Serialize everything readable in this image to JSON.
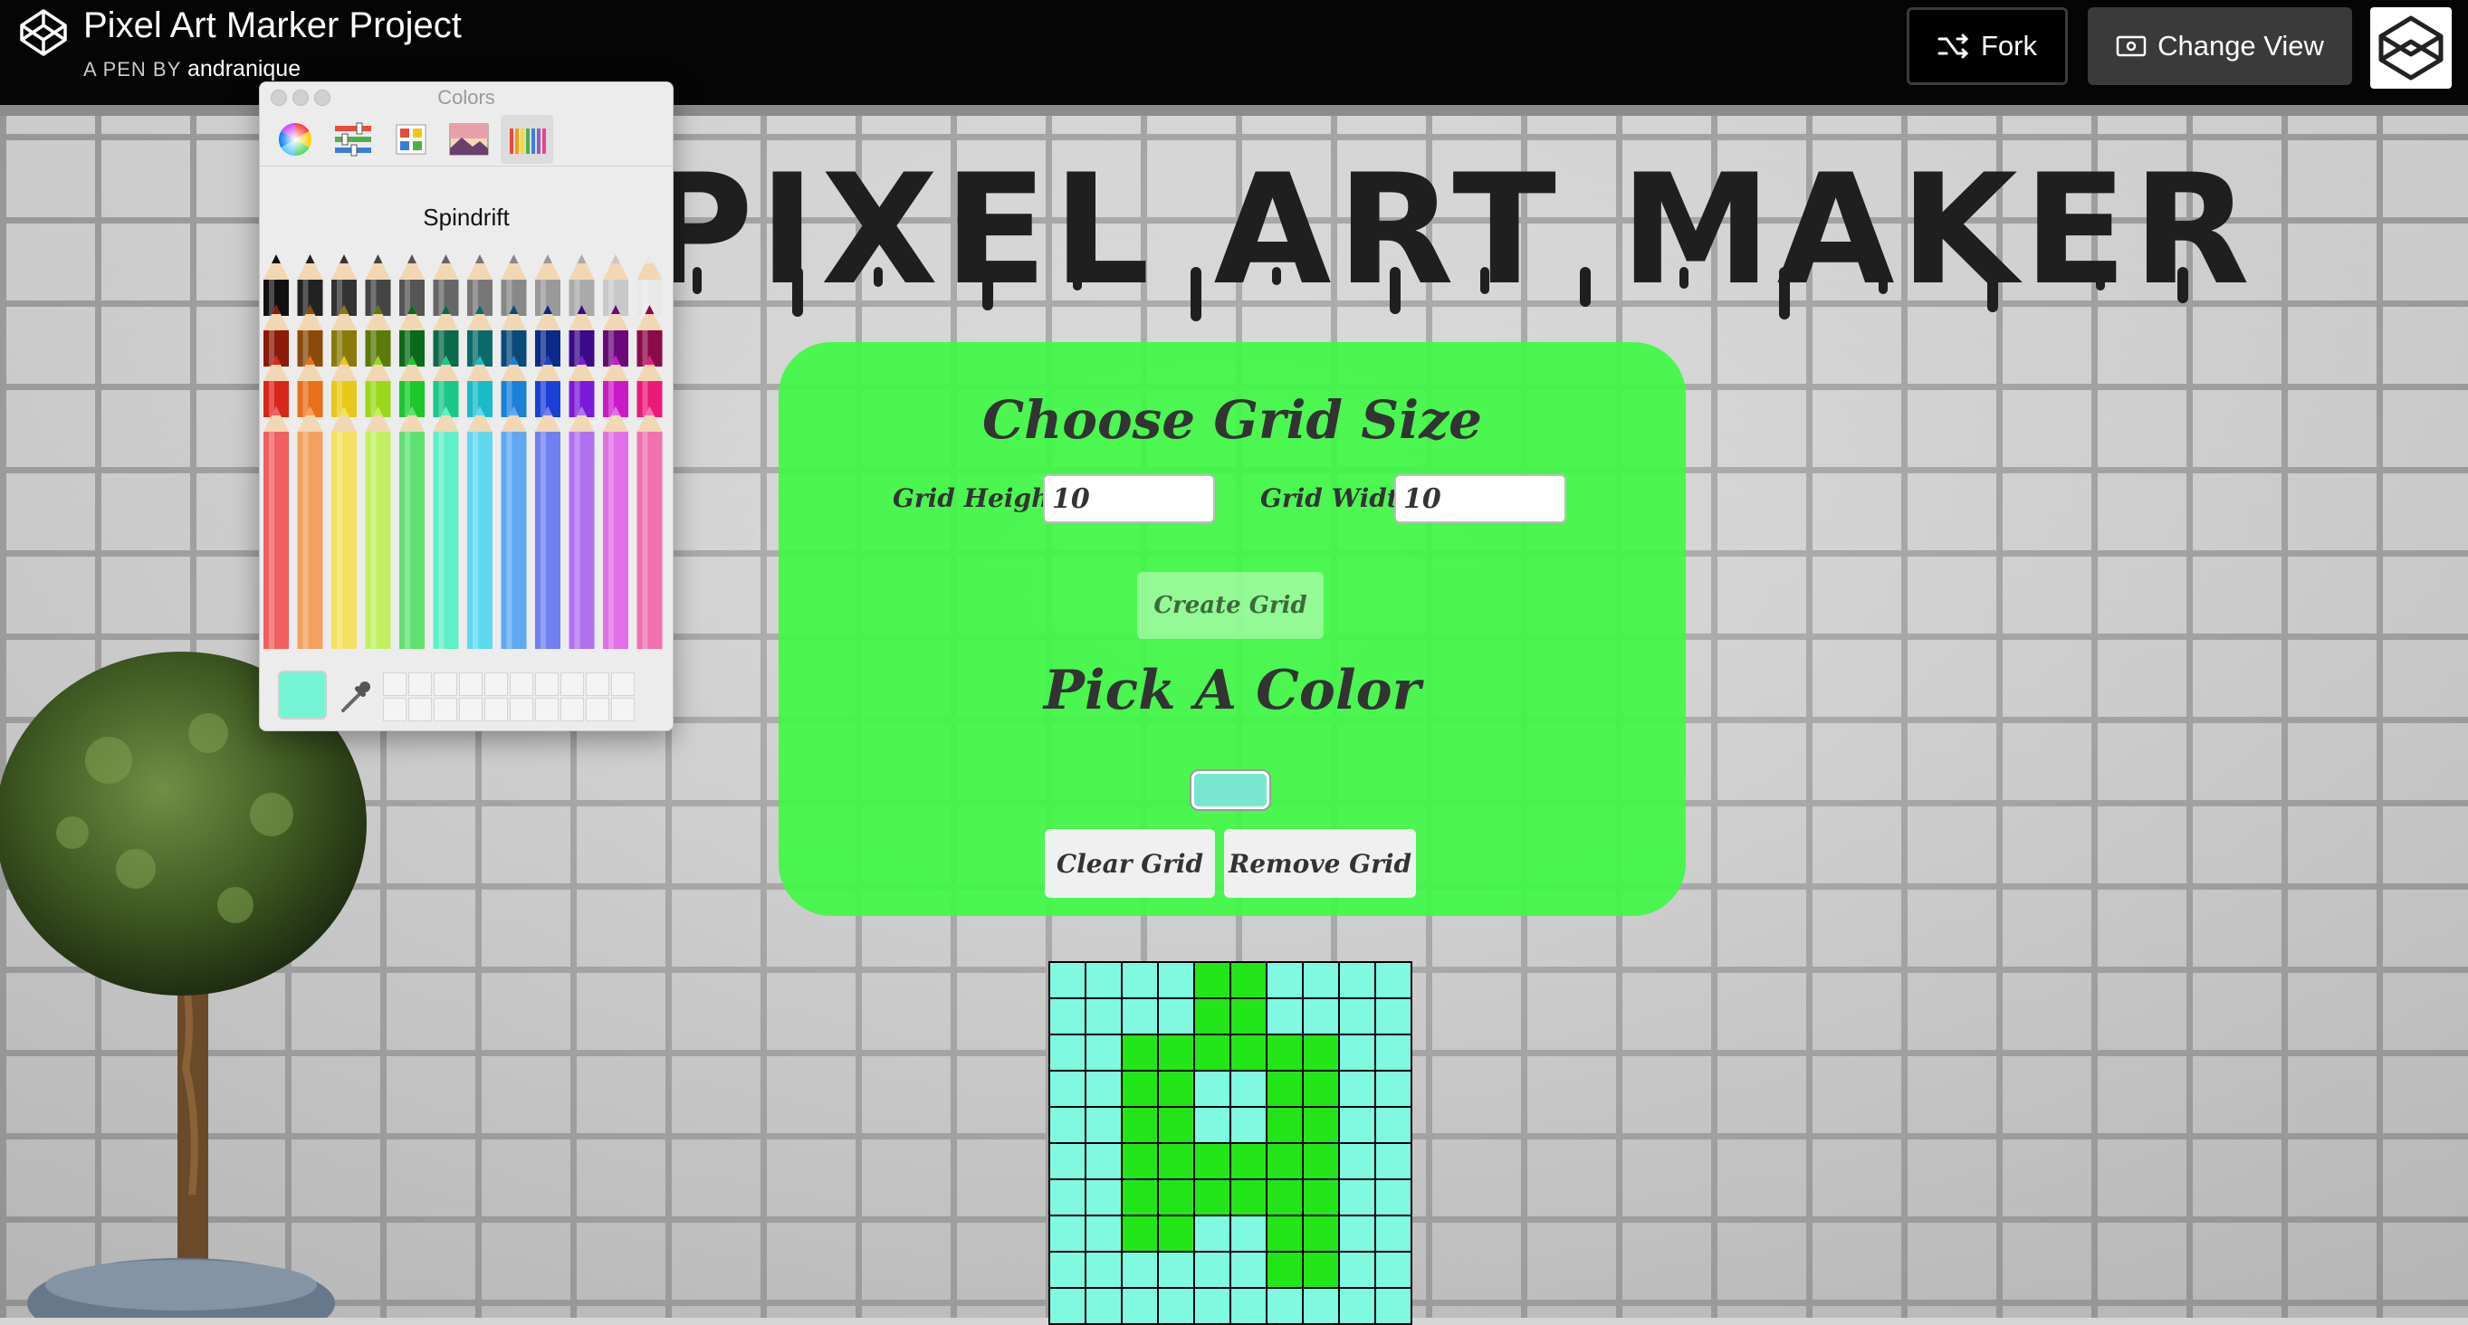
{
  "header": {
    "title": "Pixel Art Marker Project",
    "byline_prefix": "A PEN BY",
    "author": "andranique",
    "fork_label": "Fork",
    "change_view_label": "Change View"
  },
  "page": {
    "title": "PIXEL ART MAKER"
  },
  "panel": {
    "choose_grid_heading": "Choose Grid Size",
    "grid_height_label": "Grid Height:",
    "grid_height_value": "10",
    "grid_width_label": "Grid Width:",
    "grid_width_value": "10",
    "create_grid_label": "Create Grid",
    "pick_color_heading": "Pick A Color",
    "selected_color": "#79e6d0",
    "clear_grid_label": "Clear Grid",
    "remove_grid_label": "Remove Grid"
  },
  "pixel_grid": {
    "rows": 10,
    "cols": 10,
    "colors": {
      "0": "#7ffae0",
      "1": "#22e617"
    },
    "cells": [
      "0000110000",
      "0000110000",
      "0011111100",
      "0011001100",
      "0011001100",
      "0011111100",
      "0011111100",
      "0011001100",
      "0000001100",
      "0000000000"
    ]
  },
  "colors_panel": {
    "title": "Colors",
    "palette_name": "Spindrift",
    "current_color": "#76f5d6",
    "toolbar_icons": [
      "color-wheel-icon",
      "color-sliders-icon",
      "color-palettes-icon",
      "image-palettes-icon",
      "pencils-icon"
    ]
  }
}
